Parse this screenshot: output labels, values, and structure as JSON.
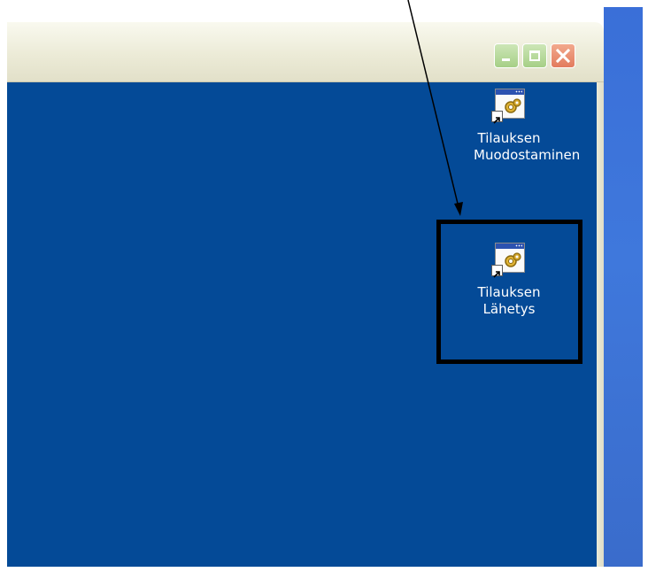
{
  "window": {
    "controls": {
      "minimize": "minimize-icon",
      "maximize": "maximize-icon",
      "close": "close-icon"
    },
    "client_color": "#044a97"
  },
  "desktop_icons": [
    {
      "line1": "Tilauksen",
      "line2": "Muodostaminen",
      "icon": "shortcut-program-icon"
    },
    {
      "line1": "Tilauksen",
      "line2": "Lähetys",
      "icon": "shortcut-program-icon",
      "highlighted": true
    }
  ],
  "annotation": {
    "highlight_color": "#000000",
    "arrow_color": "#000000"
  }
}
